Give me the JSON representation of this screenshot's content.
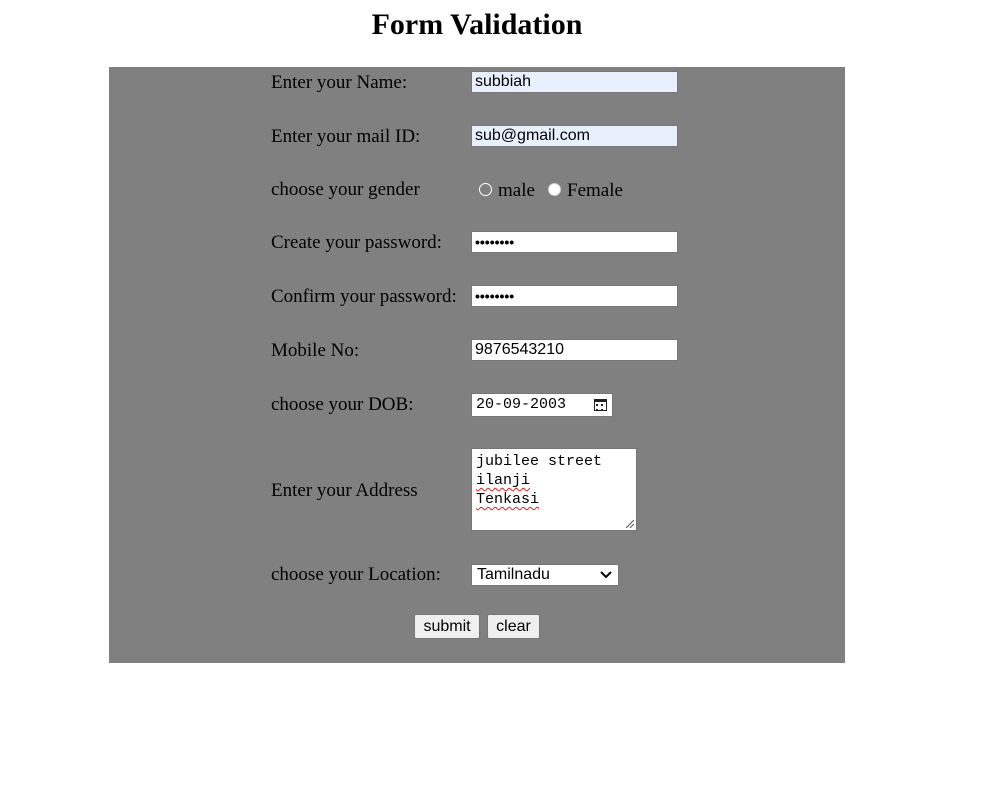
{
  "page": {
    "title": "Form Validation"
  },
  "form": {
    "name": {
      "label": "Enter your Name:",
      "value": "subbiah"
    },
    "mail": {
      "label": "Enter your mail ID:",
      "value": "sub@gmail.com"
    },
    "gender": {
      "label": "choose your gender",
      "options": [
        "male",
        "Female"
      ]
    },
    "password": {
      "label": "Create your password:",
      "masked": "••••••••"
    },
    "confirm": {
      "label": "Confirm your password:",
      "masked": "••••••••"
    },
    "mobile": {
      "label": "Mobile No:",
      "value": "9876543210"
    },
    "dob": {
      "label": "choose your DOB:",
      "value": "20-09-2003"
    },
    "address": {
      "label": "Enter your Address",
      "lines": [
        "jubilee street",
        "ilanji",
        "Tenkasi"
      ]
    },
    "location": {
      "label": "choose your Location:",
      "selected": "Tamilnadu"
    },
    "buttons": {
      "submit": "submit",
      "clear": "clear"
    }
  },
  "colors": {
    "panel": "#808080",
    "autofill": "#e8f0fe",
    "background": "#ffffff"
  },
  "icons": [
    "calendar-icon",
    "resize-grip-icon",
    "chevron-down-icon"
  ]
}
